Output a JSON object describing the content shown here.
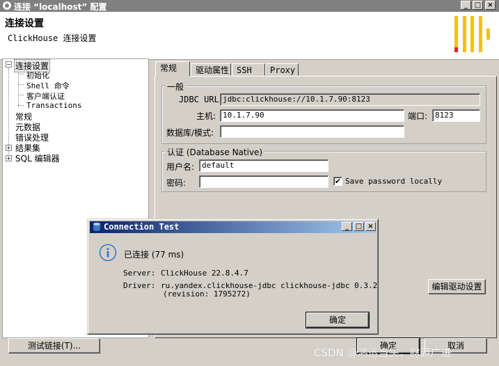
{
  "window": {
    "title": "连接 “localhost” 配置",
    "controls": [
      "_",
      "□",
      "×"
    ]
  },
  "header": {
    "title": "连接设置",
    "subtitle": "ClickHouse 连接设置"
  },
  "tree": {
    "items": [
      {
        "label": "连接设置",
        "expander": "−"
      },
      {
        "label": "初始化"
      },
      {
        "label": "Shell 命令"
      },
      {
        "label": "客户端认证"
      },
      {
        "label": "Transactions"
      },
      {
        "label": "常规"
      },
      {
        "label": "元数据"
      },
      {
        "label": "错误处理"
      },
      {
        "label": "结果集",
        "expander": "+"
      },
      {
        "label": "SQL 编辑器",
        "expander": "+"
      }
    ]
  },
  "tabs": [
    "常规",
    "驱动属性",
    "SSH",
    "Proxy"
  ],
  "general": {
    "legend": "一般",
    "jdbc_label": "JDBC URL:",
    "jdbc_value": "jdbc:clickhouse://10.1.7.90:8123",
    "host_label": "主机:",
    "host_value": "10.1.7.90",
    "port_label": "端口:",
    "port_value": "8123",
    "db_label": "数据库/模式:",
    "db_value": ""
  },
  "auth": {
    "legend": "认证 (Database Native)",
    "user_label": "用户名:",
    "user_value": "default",
    "password_label": "密码:",
    "password_value": "",
    "save_password_label": "Save password locally",
    "save_password_checked": "✔"
  },
  "buttons": {
    "edit_driver": "编辑驱动设置",
    "test_connection": "测试链接(T)...",
    "ok": "确定",
    "cancel": "取消"
  },
  "dialog": {
    "title": "Connection Test",
    "controls": [
      "_",
      "□",
      "×"
    ],
    "status": "已连接 (77 ms)",
    "server_label": "Server:",
    "server_value": "ClickHouse 22.8.4.7",
    "driver_label": "Driver:",
    "driver_value": "ru.yandex.clickhouse-jdbc clickhouse-jdbc 0.3.2",
    "driver_revision": "(revision: 1795272)",
    "ok": "确定"
  },
  "watermark": "CSDN @鸿运当头，财源广进",
  "colors": {
    "dialog_title_start": "#0a246a",
    "dialog_title_end": "#a6caf0",
    "logo_yellow": "#f2c400",
    "logo_red": "#e8212e",
    "info_blue": "#3a78c2"
  }
}
